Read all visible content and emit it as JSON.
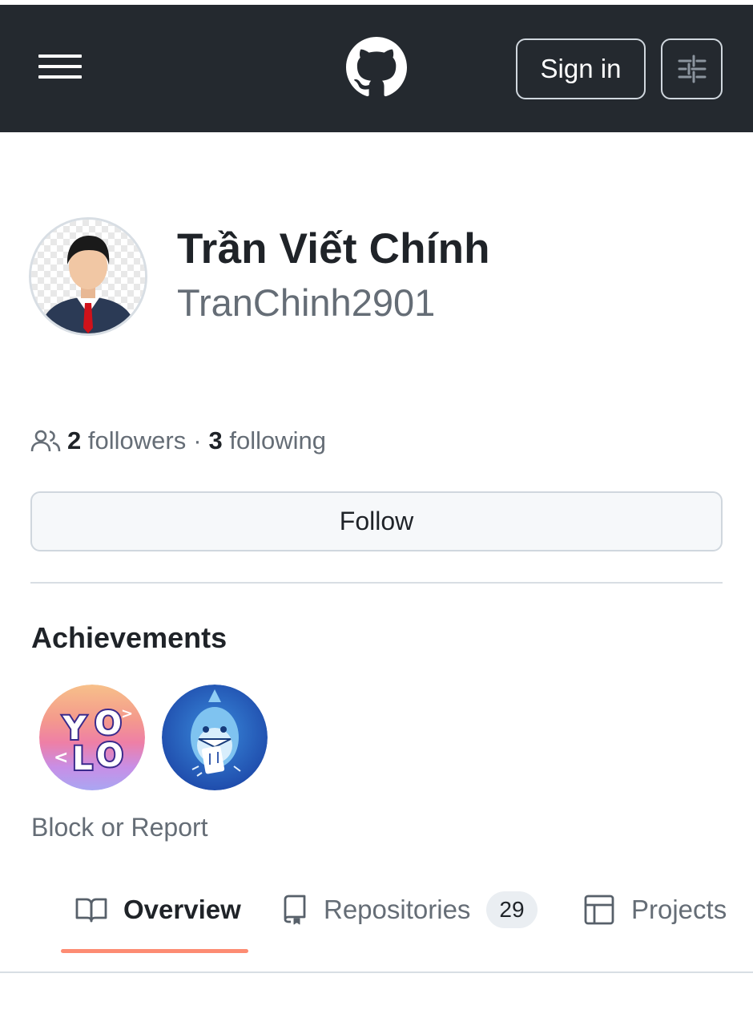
{
  "header": {
    "sign_in_label": "Sign in",
    "menu_icon": "hamburger-icon",
    "logo_icon": "github-mark-icon",
    "settings_icon": "sliders-icon",
    "background_color": "#24292f"
  },
  "profile": {
    "full_name": "Trần Viết Chính",
    "username": "TranChinh2901",
    "followers_count": "2",
    "followers_label": "followers",
    "separator": "·",
    "following_count": "3",
    "following_label": "following",
    "follow_label": "Follow"
  },
  "achievements": {
    "title": "Achievements",
    "badges": [
      {
        "name": "yolo-badge",
        "text": "YOLO"
      },
      {
        "name": "pull-shark-badge",
        "text": ""
      }
    ]
  },
  "block_report_label": "Block or Report",
  "tabs": {
    "items": [
      {
        "label": "Overview",
        "icon": "book-icon",
        "active": true
      },
      {
        "label": "Repositories",
        "icon": "repo-icon",
        "counter": "29"
      },
      {
        "label": "Projects",
        "icon": "table-icon"
      }
    ],
    "active_color": "#fd8c73"
  }
}
